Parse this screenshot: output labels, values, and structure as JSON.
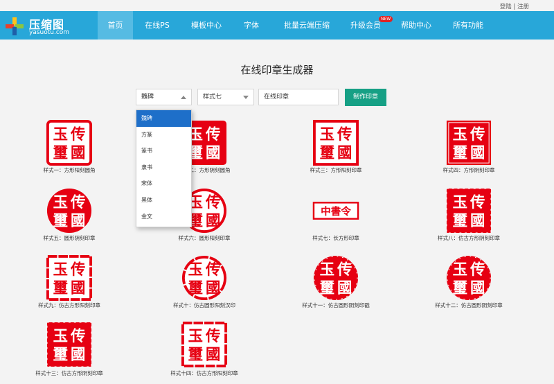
{
  "top_links": {
    "login": "登陆",
    "sep": "|",
    "register": "注册"
  },
  "logo": {
    "name": "压缩图",
    "domain": "yasuotu.com"
  },
  "nav": [
    {
      "label": "首页"
    },
    {
      "label": "在线PS"
    },
    {
      "label": "模板中心"
    },
    {
      "label": "字体"
    },
    {
      "label": "批量云端压缩"
    },
    {
      "label": "升级会员",
      "badge": "NEW"
    },
    {
      "label": "帮助中心"
    },
    {
      "label": "所有功能"
    }
  ],
  "page_title": "在线印章生成器",
  "form": {
    "font_select": "魏碑",
    "style_select": "样式七",
    "text_input": "在线印章",
    "submit": "制作印章"
  },
  "font_options": [
    "魏碑",
    "方篆",
    "篆书",
    "隶书",
    "宋体",
    "黑体",
    "金文"
  ],
  "seal_chars": {
    "c1": "传",
    "c2": "國",
    "c3": "玉",
    "c4": "璽",
    "rect": "中書令"
  },
  "seal_color": "#e60012",
  "seals": [
    {
      "caption": "样式一：方形阳刻圆角"
    },
    {
      "caption": "样式二：方形阴刻圆角"
    },
    {
      "caption": "样式三：方形阳刻印章"
    },
    {
      "caption": "样式四：方形阴刻印章"
    },
    {
      "caption": "样式五：圆形阴刻印章"
    },
    {
      "caption": "样式六：圆形阳刻印章"
    },
    {
      "caption": "样式七：长方形印章"
    },
    {
      "caption": "样式八：仿古方形阴刻印章"
    },
    {
      "caption": "样式九：仿古方形阳刻印章"
    },
    {
      "caption": "样式十：仿古圆形阳刻汉印"
    },
    {
      "caption": "样式十一：仿古圆形阴刻印戳"
    },
    {
      "caption": "样式十二：仿古圆形阴刻印章"
    },
    {
      "caption": "样式十三：仿古方形阴刻印章"
    },
    {
      "caption": "样式十四：仿古方形阳刻印章"
    }
  ]
}
